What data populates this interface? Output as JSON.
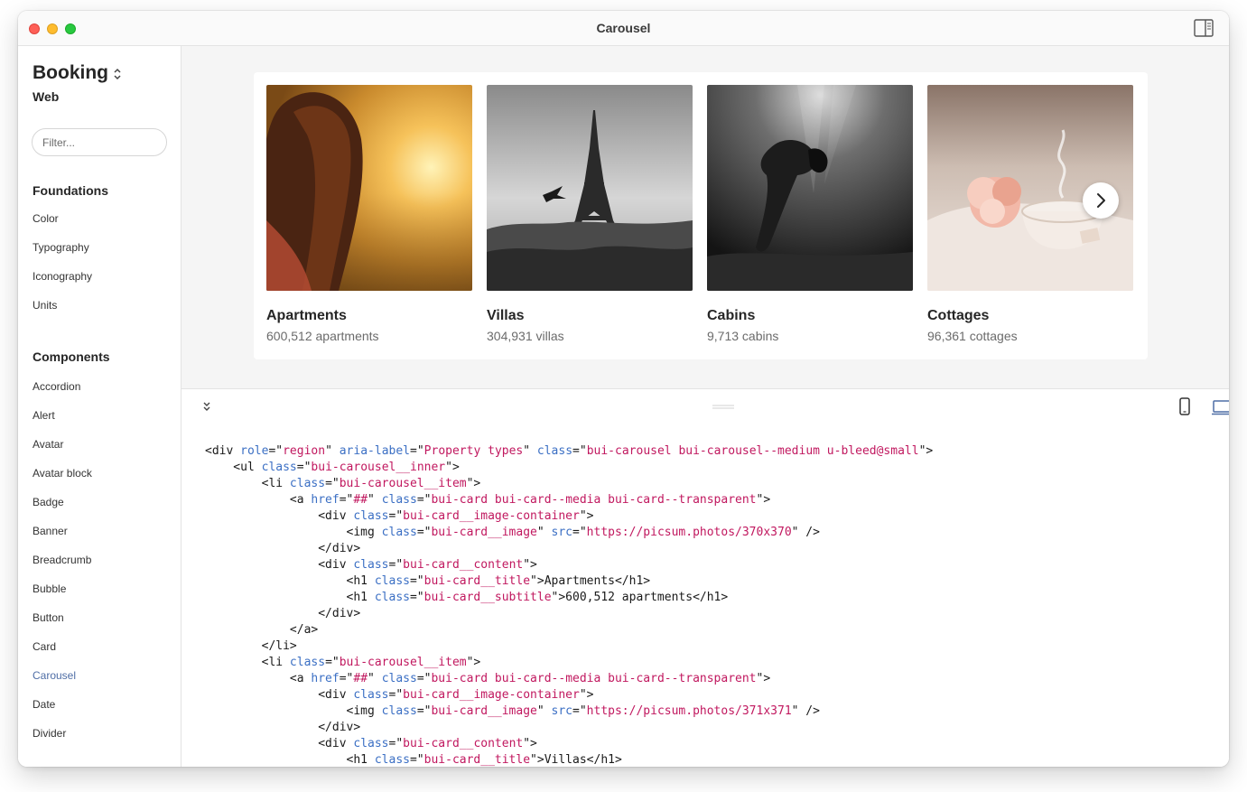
{
  "window": {
    "title": "Carousel"
  },
  "sidebar": {
    "brand": "Booking",
    "platform": "Web",
    "filter_placeholder": "Filter...",
    "foundations": {
      "heading": "Foundations",
      "items": [
        "Color",
        "Typography",
        "Iconography",
        "Units"
      ]
    },
    "components": {
      "heading": "Components",
      "items": [
        "Accordion",
        "Alert",
        "Avatar",
        "Avatar block",
        "Badge",
        "Banner",
        "Breadcrumb",
        "Bubble",
        "Button",
        "Card",
        "Carousel",
        "Date",
        "Divider"
      ],
      "active": "Carousel"
    }
  },
  "carousel": {
    "cards": [
      {
        "title": "Apartments",
        "subtitle": "600,512 apartments",
        "image": "sunset-portrait"
      },
      {
        "title": "Villas",
        "subtitle": "304,931 villas",
        "image": "eiffel-tower-bw"
      },
      {
        "title": "Cabins",
        "subtitle": "9,713 cabins",
        "image": "underwater-bw"
      },
      {
        "title": "Cottages",
        "subtitle": "96,361 cottages",
        "image": "teacup-still-life"
      }
    ],
    "next_icon": "chevron-right-icon"
  },
  "toolbar": {
    "collapse_icon": "chevrons-down-icon",
    "mobile_icon": "mobile-device-icon",
    "desktop_icon": "laptop-device-icon",
    "active_view": "desktop"
  },
  "code_lines": [
    [
      [
        "t",
        "<div "
      ],
      [
        "a",
        "role"
      ],
      [
        "t",
        "=\""
      ],
      [
        "v",
        "region"
      ],
      [
        "t",
        "\" "
      ],
      [
        "a",
        "aria-label"
      ],
      [
        "t",
        "=\""
      ],
      [
        "v",
        "Property types"
      ],
      [
        "t",
        "\" "
      ],
      [
        "a",
        "class"
      ],
      [
        "t",
        "=\""
      ],
      [
        "v",
        "bui-carousel bui-carousel--medium u-bleed@small"
      ],
      [
        "t",
        "\">"
      ]
    ],
    [
      [
        "t",
        "    <ul "
      ],
      [
        "a",
        "class"
      ],
      [
        "t",
        "=\""
      ],
      [
        "v",
        "bui-carousel__inner"
      ],
      [
        "t",
        "\">"
      ]
    ],
    [
      [
        "t",
        "        <li "
      ],
      [
        "a",
        "class"
      ],
      [
        "t",
        "=\""
      ],
      [
        "v",
        "bui-carousel__item"
      ],
      [
        "t",
        "\">"
      ]
    ],
    [
      [
        "t",
        "            <a "
      ],
      [
        "a",
        "href"
      ],
      [
        "t",
        "=\""
      ],
      [
        "v",
        "##"
      ],
      [
        "t",
        "\" "
      ],
      [
        "a",
        "class"
      ],
      [
        "t",
        "=\""
      ],
      [
        "v",
        "bui-card bui-card--media bui-card--transparent"
      ],
      [
        "t",
        "\">"
      ]
    ],
    [
      [
        "t",
        "                <div "
      ],
      [
        "a",
        "class"
      ],
      [
        "t",
        "=\""
      ],
      [
        "v",
        "bui-card__image-container"
      ],
      [
        "t",
        "\">"
      ]
    ],
    [
      [
        "t",
        "                    <img "
      ],
      [
        "a",
        "class"
      ],
      [
        "t",
        "=\""
      ],
      [
        "v",
        "bui-card__image"
      ],
      [
        "t",
        "\" "
      ],
      [
        "a",
        "src"
      ],
      [
        "t",
        "=\""
      ],
      [
        "v",
        "https://picsum.photos/370x370"
      ],
      [
        "t",
        "\" />"
      ]
    ],
    [
      [
        "t",
        "                </div>"
      ]
    ],
    [
      [
        "t",
        "                <div "
      ],
      [
        "a",
        "class"
      ],
      [
        "t",
        "=\""
      ],
      [
        "v",
        "bui-card__content"
      ],
      [
        "t",
        "\">"
      ]
    ],
    [
      [
        "t",
        "                    <h1 "
      ],
      [
        "a",
        "class"
      ],
      [
        "t",
        "=\""
      ],
      [
        "v",
        "bui-card__title"
      ],
      [
        "t",
        "\">Apartments</h1>"
      ]
    ],
    [
      [
        "t",
        "                    <h1 "
      ],
      [
        "a",
        "class"
      ],
      [
        "t",
        "=\""
      ],
      [
        "v",
        "bui-card__subtitle"
      ],
      [
        "t",
        "\">600,512 apartments</h1>"
      ]
    ],
    [
      [
        "t",
        "                </div>"
      ]
    ],
    [
      [
        "t",
        "            </a>"
      ]
    ],
    [
      [
        "t",
        "        </li>"
      ]
    ],
    [
      [
        "t",
        "        <li "
      ],
      [
        "a",
        "class"
      ],
      [
        "t",
        "=\""
      ],
      [
        "v",
        "bui-carousel__item"
      ],
      [
        "t",
        "\">"
      ]
    ],
    [
      [
        "t",
        "            <a "
      ],
      [
        "a",
        "href"
      ],
      [
        "t",
        "=\""
      ],
      [
        "v",
        "##"
      ],
      [
        "t",
        "\" "
      ],
      [
        "a",
        "class"
      ],
      [
        "t",
        "=\""
      ],
      [
        "v",
        "bui-card bui-card--media bui-card--transparent"
      ],
      [
        "t",
        "\">"
      ]
    ],
    [
      [
        "t",
        "                <div "
      ],
      [
        "a",
        "class"
      ],
      [
        "t",
        "=\""
      ],
      [
        "v",
        "bui-card__image-container"
      ],
      [
        "t",
        "\">"
      ]
    ],
    [
      [
        "t",
        "                    <img "
      ],
      [
        "a",
        "class"
      ],
      [
        "t",
        "=\""
      ],
      [
        "v",
        "bui-card__image"
      ],
      [
        "t",
        "\" "
      ],
      [
        "a",
        "src"
      ],
      [
        "t",
        "=\""
      ],
      [
        "v",
        "https://picsum.photos/371x371"
      ],
      [
        "t",
        "\" />"
      ]
    ],
    [
      [
        "t",
        "                </div>"
      ]
    ],
    [
      [
        "t",
        "                <div "
      ],
      [
        "a",
        "class"
      ],
      [
        "t",
        "=\""
      ],
      [
        "v",
        "bui-card__content"
      ],
      [
        "t",
        "\">"
      ]
    ],
    [
      [
        "t",
        "                    <h1 "
      ],
      [
        "a",
        "class"
      ],
      [
        "t",
        "=\""
      ],
      [
        "v",
        "bui-card__title"
      ],
      [
        "t",
        "\">Villas</h1>"
      ]
    ]
  ],
  "colors": {
    "active_nav": "#4f6ea6",
    "code_attr": "#3b6fc4",
    "code_value": "#c1185f",
    "preview_bg": "#f5f5f5"
  }
}
